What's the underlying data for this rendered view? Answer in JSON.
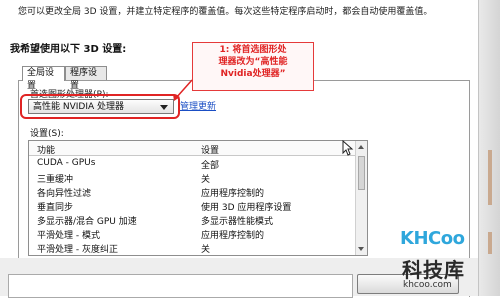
{
  "intro_text": "您可以更改全局 3D 设置，并建立特定程序的覆盖值。每次这些特定程序启动时，都会自动使用覆盖值。",
  "section_title": "我希望使用以下 3D 设置:",
  "annotation": {
    "line1": "1: 将首选图形处",
    "line2": "理器改为“高性能",
    "line3": "Nvidia处理器”",
    "color": "#e02424"
  },
  "tabs": [
    {
      "label": "全局设置",
      "active": true
    },
    {
      "label": "程序设置",
      "active": false
    }
  ],
  "gpu_label": "首选图形处理器(P):",
  "gpu_select": {
    "value": "高性能 NVIDIA 处理器"
  },
  "manage_link": "管理更新",
  "settings_label": "设置(S):",
  "grid": {
    "headers": [
      "功能",
      "设置"
    ],
    "rows": [
      {
        "feature": "CUDA - GPUs",
        "value": "全部"
      },
      {
        "feature": "三重缓冲",
        "value": "关"
      },
      {
        "feature": "各向异性过滤",
        "value": "应用程序控制的"
      },
      {
        "feature": "垂直同步",
        "value": "使用 3D 应用程序设置"
      },
      {
        "feature": "多显示器/混合 GPU 加速",
        "value": "多显示器性能模式"
      },
      {
        "feature": "平滑处理 - 模式",
        "value": "应用程序控制的"
      },
      {
        "feature": "平滑处理 - 灰度纠正",
        "value": "关"
      }
    ]
  },
  "watermark": {
    "mark": "KHCoo",
    "brand": "科技库",
    "domain": "khcoo.com"
  }
}
